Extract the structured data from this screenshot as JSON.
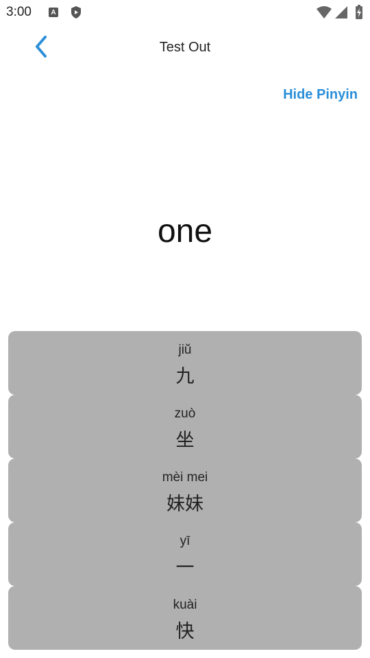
{
  "status_bar": {
    "time": "3:00"
  },
  "app_bar": {
    "title": "Test Out",
    "back_icon": "chevron-left-icon"
  },
  "controls": {
    "hide_pinyin_label": "Hide Pinyin"
  },
  "prompt": {
    "word": "one"
  },
  "options": [
    {
      "pinyin": "jiŭ",
      "hanzi": "九"
    },
    {
      "pinyin": "zuò",
      "hanzi": "坐"
    },
    {
      "pinyin": "mèi mei",
      "hanzi": "妹妹"
    },
    {
      "pinyin": "yī",
      "hanzi": "一"
    },
    {
      "pinyin": "kuài",
      "hanzi": "快"
    }
  ],
  "colors": {
    "accent": "#2b8fd9",
    "option_bg": "#b0b0b0"
  }
}
